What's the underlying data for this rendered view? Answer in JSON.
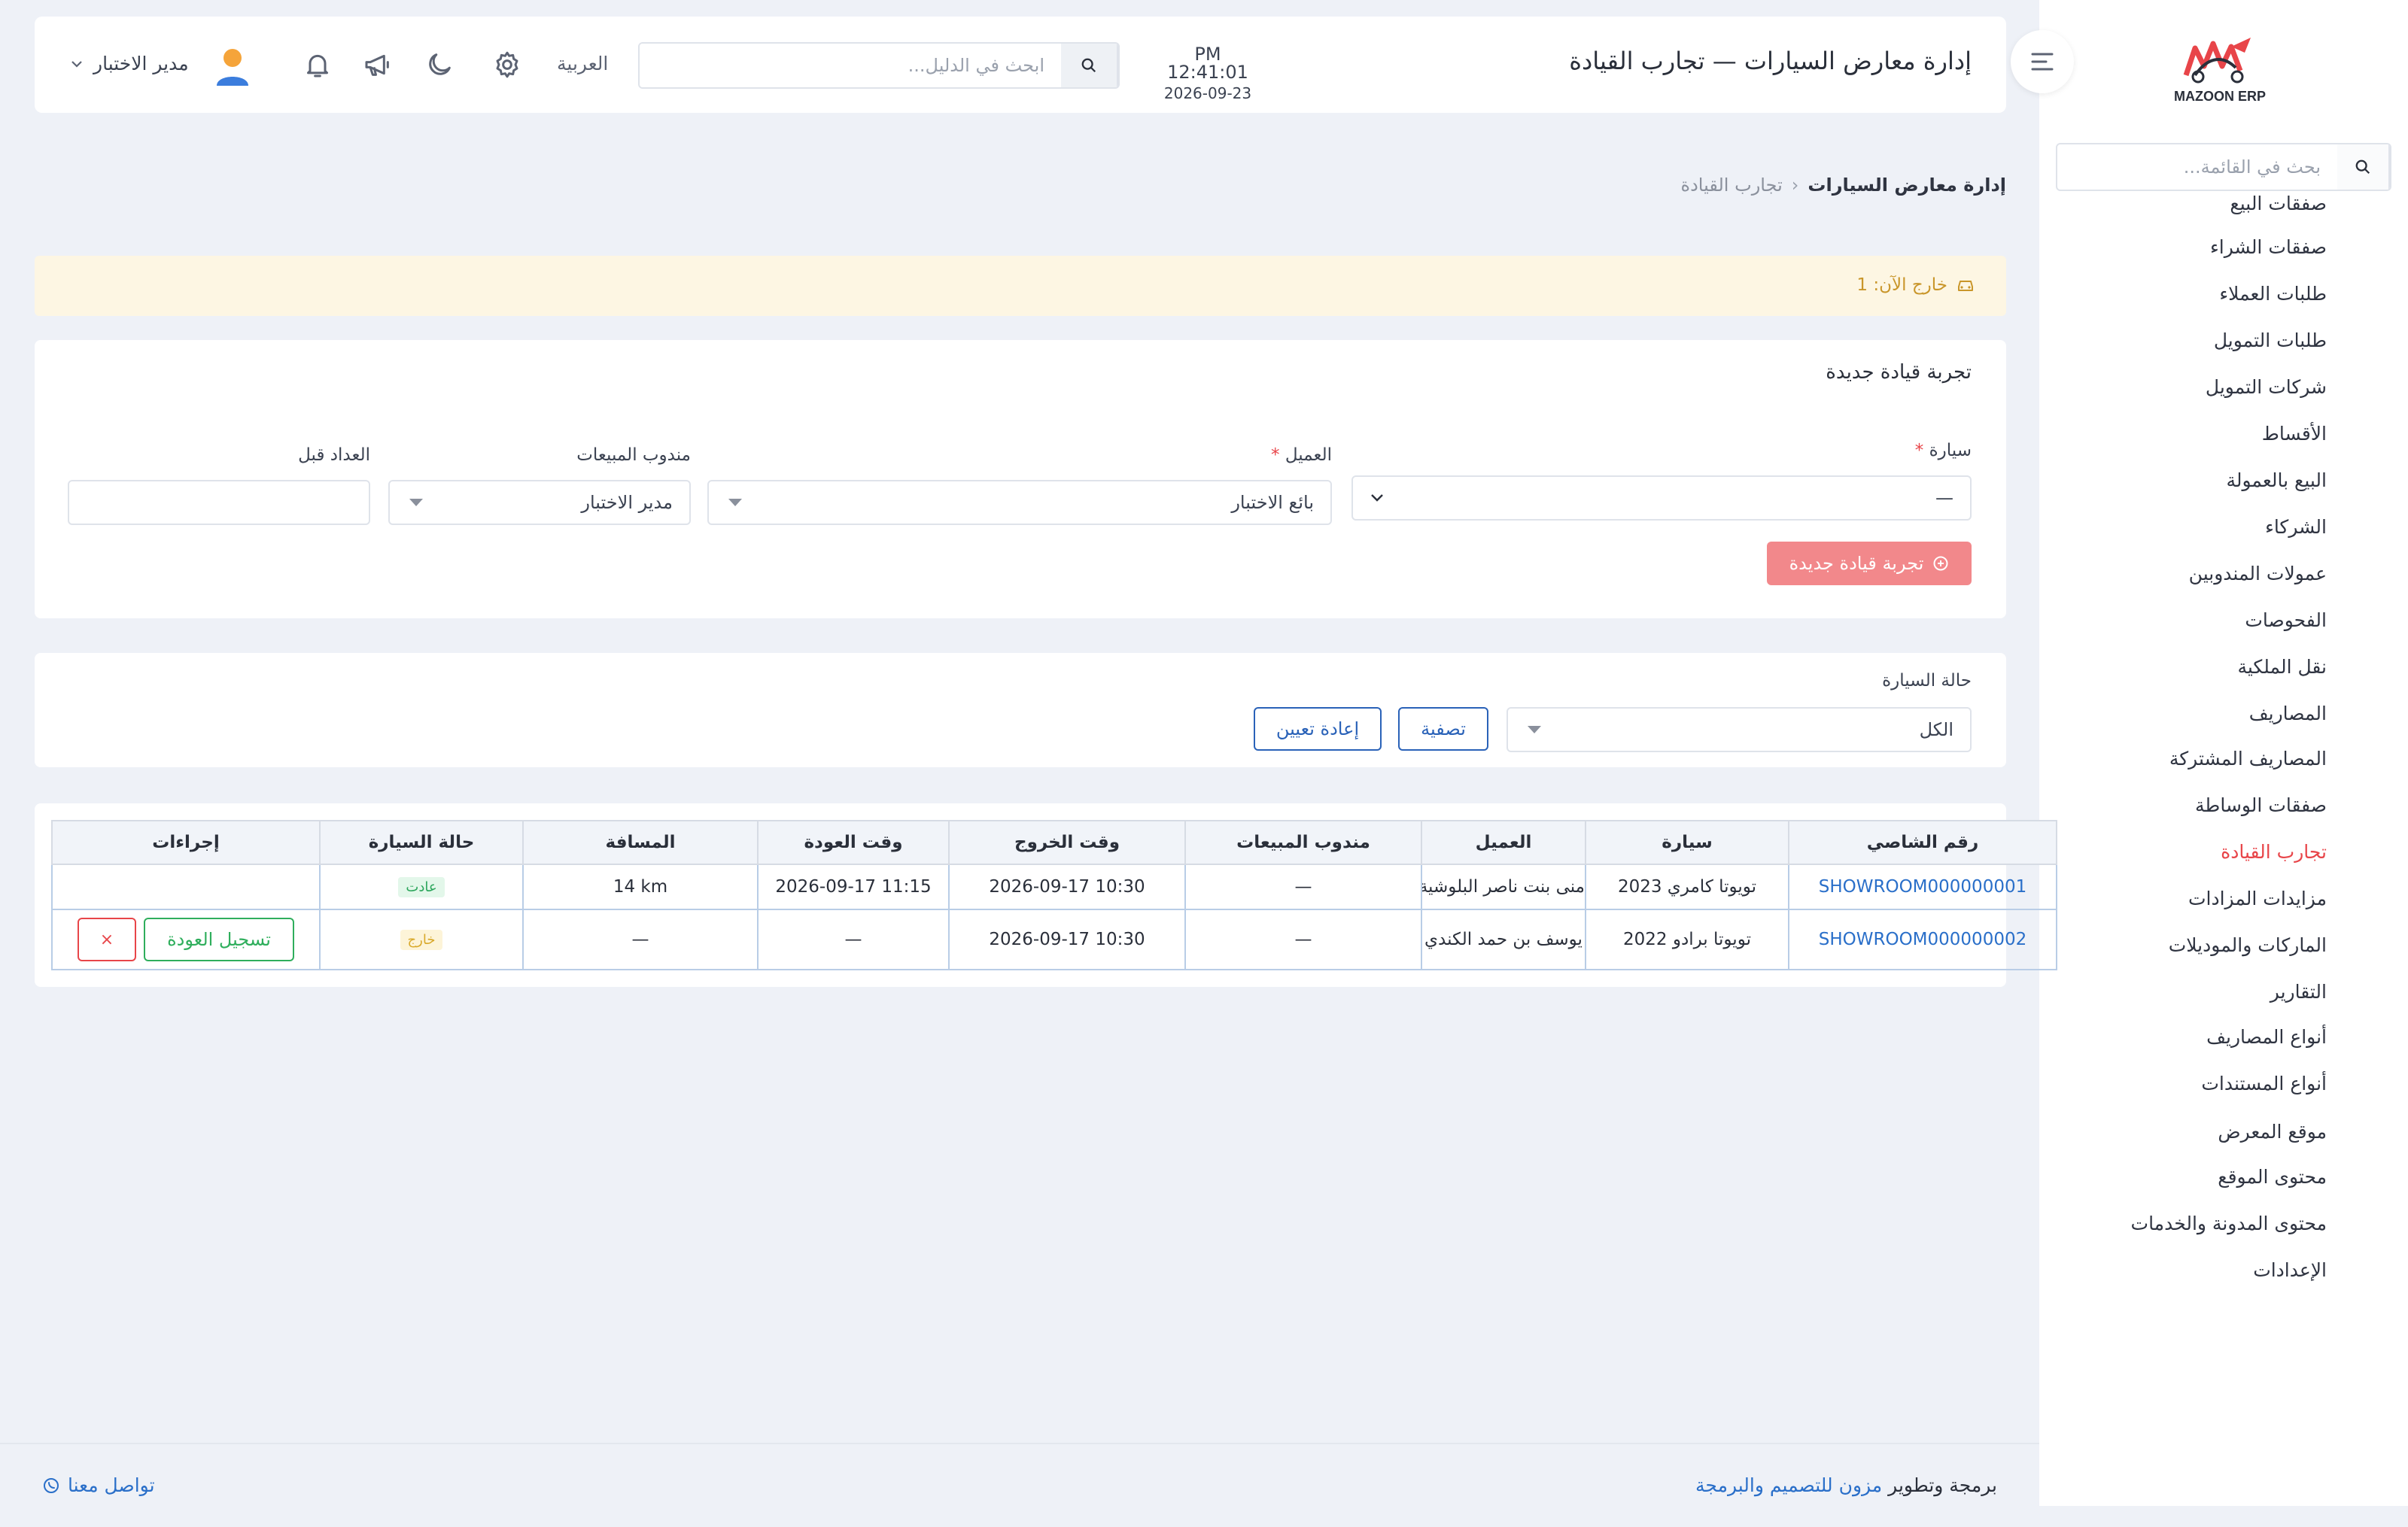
{
  "app": {
    "logo_text": "MAZOON ERP",
    "brand_color": "#e84549"
  },
  "sidebar": {
    "search_placeholder": "بحث في القائمة...",
    "items": [
      {
        "label": "صفقات البيع"
      },
      {
        "label": "صفقات الشراء"
      },
      {
        "label": "طلبات العملاء"
      },
      {
        "label": "طلبات التمويل"
      },
      {
        "label": "شركات التمويل"
      },
      {
        "label": "الأقساط"
      },
      {
        "label": "البيع بالعمولة"
      },
      {
        "label": "الشركاء"
      },
      {
        "label": "عمولات المندوبين"
      },
      {
        "label": "الفحوصات"
      },
      {
        "label": "نقل الملكية"
      },
      {
        "label": "المصاريف"
      },
      {
        "label": "المصاريف المشتركة"
      },
      {
        "label": "صفقات الوساطة"
      },
      {
        "label": "تجارب القيادة",
        "active": true
      },
      {
        "label": "مزايدات المزادات"
      },
      {
        "label": "الماركات والموديلات"
      },
      {
        "label": "التقارير"
      },
      {
        "label": "أنواع المصاريف"
      },
      {
        "label": "أنواع المستندات"
      },
      {
        "label": "موقع المعرض"
      },
      {
        "label": "محتوى الموقع"
      },
      {
        "label": "محتوى المدونة والخدمات"
      },
      {
        "label": "الإعدادات"
      }
    ]
  },
  "header": {
    "title": "إدارة معارض السيارات — تجارب القيادة",
    "time": "PM 12:41:01",
    "date": "2026-09-23",
    "search_placeholder": "ابحث في الدليل...",
    "language": "العربية",
    "user_name": "مدير الاختبار"
  },
  "breadcrumb": {
    "parent": "إدارة معارض السيارات",
    "current": "تجارب القيادة"
  },
  "alert": {
    "text": "خارج الآن: 1"
  },
  "form": {
    "title": "تجربة قيادة جديدة",
    "car_label": "سيارة",
    "car_value": "—",
    "customer_label": "العميل",
    "customer_value": "بائع الاختبار",
    "salesrep_label": "مندوب المبيعات",
    "salesrep_value": "مدير الاختبار",
    "odometer_label": "العداد قبل",
    "odometer_value": "",
    "required_mark": "*",
    "submit_label": "تجربة قيادة جديدة"
  },
  "filter": {
    "status_label": "حالة السيارة",
    "status_value": "الكل",
    "filter_button": "تصفية",
    "reset_button": "إعادة تعيين"
  },
  "table": {
    "headers": {
      "chassis": "رقم الشاصي",
      "car": "سيارة",
      "customer": "العميل",
      "salesrep": "مندوب المبيعات",
      "out_time": "وقت الخروج",
      "return_time": "وقت العودة",
      "distance": "المسافة",
      "status": "حالة السيارة",
      "actions": "إجراءات"
    },
    "rows": [
      {
        "chassis": "SHOWROOM000000001",
        "car": "تويوتا كامري 2023",
        "customer": "منى بنت ناصر البلوشية",
        "salesrep": "—",
        "out_time": "2026-09-17 10:30",
        "return_time": "2026-09-17 11:15",
        "distance": "14 km",
        "status": "عادت"
      },
      {
        "chassis": "SHOWROOM000000002",
        "car": "تويوتا برادو 2022",
        "customer": "يوسف بن حمد الكندي",
        "salesrep": "—",
        "out_time": "2026-09-17 10:30",
        "return_time": "—",
        "distance": "—",
        "status": "خارج",
        "action_return": "تسجيل العودة",
        "action_cancel": "×"
      }
    ]
  },
  "footer": {
    "credit_prefix": "برمجة وتطوير",
    "credit_link": "مزون للتصميم والبرمجة",
    "contact": "تواصل معنا"
  }
}
